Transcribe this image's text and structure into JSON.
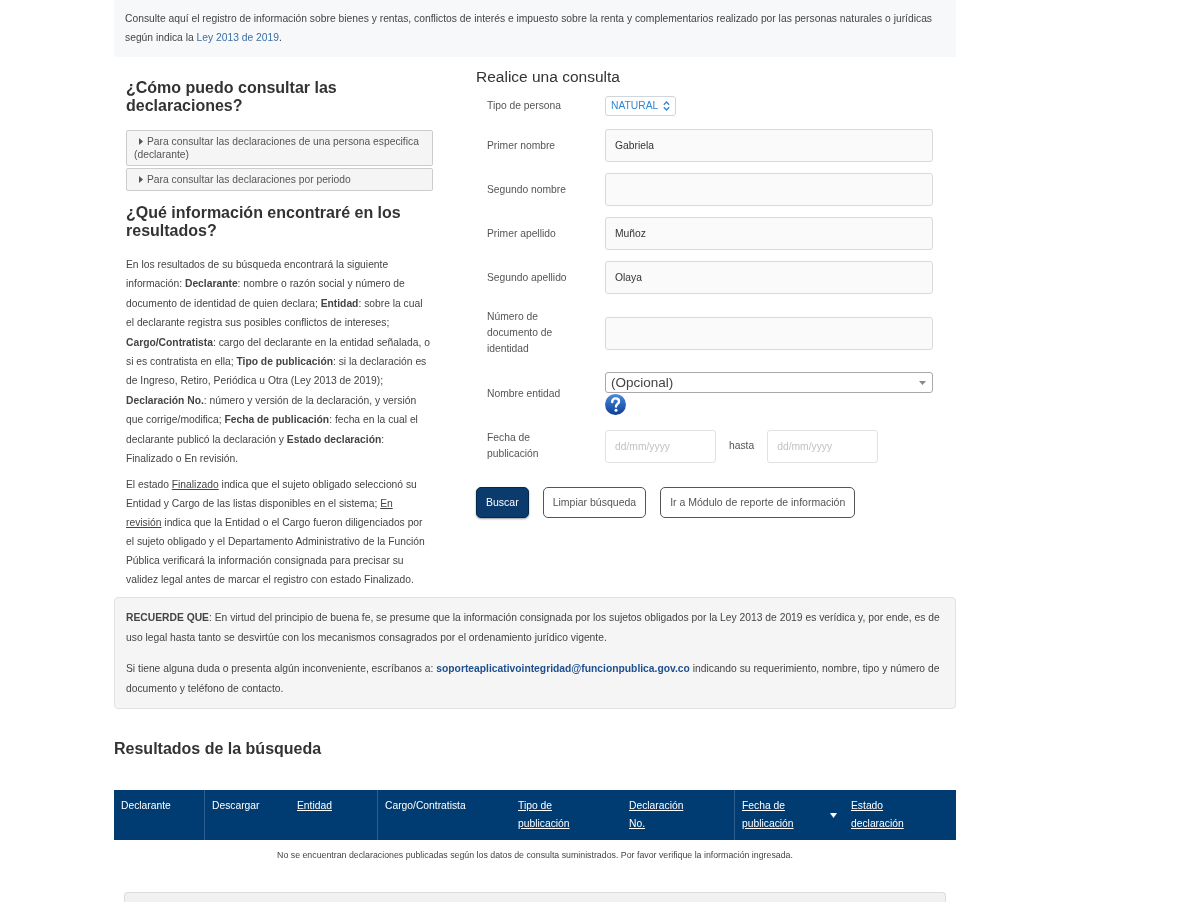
{
  "intro": {
    "text": "Consulte aquí el registro de información sobre bienes y rentas, conflictos de interés e impuesto sobre la renta y complementarios realizado por las personas naturales o jurídicas según indica la ",
    "link": "Ley 2013 de 2019",
    "text_after": "."
  },
  "guide": {
    "how_title": "¿Cómo puedo consultar las declaraciones?",
    "accordion": [
      {
        "label": "Para consultar las declaraciones de una persona especifica (declarante)",
        "expanded": false
      },
      {
        "label": "Para consultar las declaraciones por periodo",
        "expanded": false
      }
    ],
    "results_title": "¿Qué información encontraré en los resultados?",
    "results_text": "En los resultados de su búsqueda encontrará la siguiente información: **Declarante**: nombre o razón social y número de documento de identidad de quien declara; **Entidad**: sobre la cual el declarante registra sus posibles conflictos de intereses; **Cargo/Contratista**: cargo del declarante en la entidad señalada, o si es contratista en ella; **Tipo de publicación**: si la declaración es de Ingreso, Retiro, Periódica u Otra (Ley 2013 de 2019); **Declaración No.**: número y versión de la declaración, y versión que corrige/modifica; **Fecha de publicación**: fecha en la cual el declarante publicó la declaración y **Estado declaración**: Finalizado o En revisión.",
    "status_note": [
      {
        "text": "El estado ",
        "underlined": false
      },
      {
        "text": "Finalizado",
        "underlined": true
      },
      {
        "text": " indica que el sujeto obligado seleccionó su Entidad y Cargo de las listas disponibles en el sistema; ",
        "underlined": false
      },
      {
        "text": "En revisión",
        "underlined": true
      },
      {
        "text": " indica que la Entidad o el Cargo fueron diligenciados por el sujeto obligado y el Departamento Administrativo de la Función Pública verificará la información consignada para precisar su validez legal antes de marcar el registro con estado Finalizado.",
        "underlined": false
      }
    ]
  },
  "query_form": {
    "title": "Realice una consulta",
    "fields": [
      {
        "kind": "select",
        "label": "Tipo de persona",
        "value": "NATURAL"
      },
      {
        "kind": "text",
        "label": "Primer nombre",
        "value": "Gabriela"
      },
      {
        "kind": "text",
        "label": "Segundo nombre"
      },
      {
        "kind": "text",
        "label": "Primer apellido",
        "value": "Muñoz"
      },
      {
        "kind": "text",
        "label": "Segundo apellido",
        "value": "Olaya"
      },
      {
        "kind": "text",
        "label": "Número de documento de identidad"
      },
      {
        "kind": "combo",
        "label": "Nombre entidad",
        "placeholder": "(Opcional)"
      },
      {
        "kind": "date_range",
        "label": "Fecha de publicación",
        "from_placeholder": "dd/mm/yyyy",
        "separator": "hasta",
        "to_placeholder": "dd/mm/yyyy"
      }
    ],
    "buttons": [
      {
        "label": "Buscar",
        "kind": "primary"
      },
      {
        "label": "Limpiar búsqueda",
        "kind": "outline"
      },
      {
        "label": "Ir a Módulo de reporte de información",
        "kind": "outline"
      }
    ]
  },
  "notice": {
    "reminder": "**RECUERDE QUE**: En virtud del principio de buena fe, se presume que la información consignada por los sujetos obligados por la Ley 2013 de 2019 es verídica y, por ende, es de uso legal hasta tanto se desvirtúe con los mecanismos consagrados por el ordenamiento jurídico vigente.",
    "contact_text": "Si tiene alguna duda o presenta algún inconveniente, escríbanos a: ",
    "contact_email": "soporteaplicativointegridad@funcionpublica.gov.co",
    "contact_text_after": " indicando su requerimiento, nombre, tipo y número de documento y teléfono de contacto."
  },
  "results": {
    "title": "Resultados de la búsqueda",
    "columns": [
      {
        "label": "Declarante",
        "sortable": false,
        "sorted": false
      },
      {
        "label": "Descargar",
        "sortable": false,
        "sorted": false
      },
      {
        "label": "Entidad",
        "sortable": true,
        "sorted": false
      },
      {
        "label": "Cargo/Contratista",
        "sortable": false,
        "sorted": false
      },
      {
        "label": "Tipo de publicación",
        "sortable": true,
        "sorted": false
      },
      {
        "label": "Declaración No.",
        "sortable": true,
        "sorted": false
      },
      {
        "label": "Fecha de publicación",
        "sortable": true,
        "sorted": true
      },
      {
        "label": "Estado declaración",
        "sortable": true,
        "sorted": false
      }
    ],
    "empty_message": "No se encuentran declaraciones publicadas según los datos de consulta suministrados. Por favor verifique la información ingresada."
  }
}
